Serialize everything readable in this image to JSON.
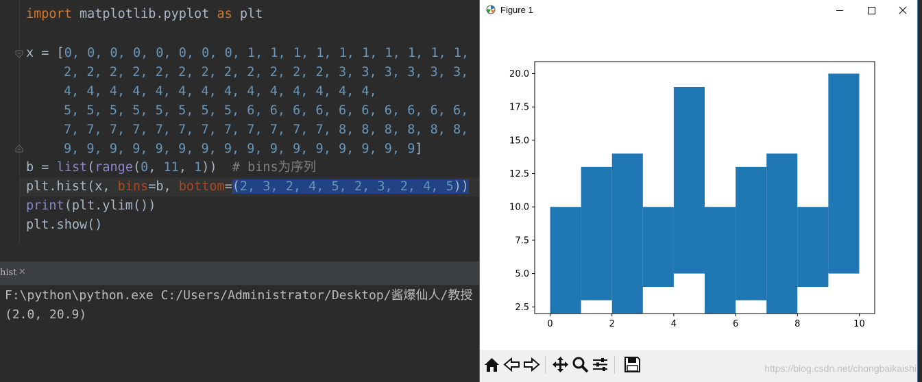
{
  "editor": {
    "line_import": {
      "kw1": "import",
      "mid": " matplotlib.pyplot ",
      "kw2": "as",
      "tail": " plt"
    },
    "x_prefix": "x = [",
    "x_rows": [
      "0, 0, 0, 0, 0, 0, 0, 0, 1, 1, 1, 1, 1, 1, 1, 1, 1, 1,",
      "2, 2, 2, 2, 2, 2, 2, 2, 2, 2, 2, 2, 3, 3, 3, 3, 3, 3,",
      "4, 4, 4, 4, 4, 4, 4, 4, 4, 4, 4, 4, 4, 4,",
      "5, 5, 5, 5, 5, 5, 5, 5, 6, 6, 6, 6, 6, 6, 6, 6, 6, 6,",
      "7, 7, 7, 7, 7, 7, 7, 7, 7, 7, 7, 7, 8, 8, 8, 8, 8, 8,",
      "9, 9, 9, 9, 9, 9, 9, 9, 9, 9, 9, 9, 9, 9, 9, 9"
    ],
    "x_suffix": "]",
    "line_b": {
      "a": "b = ",
      "fn1": "list",
      "p1": "(",
      "fn2": "range",
      "p2": "(",
      "n1": "0",
      "c1": ", ",
      "n2": "11",
      "c2": ", ",
      "n3": "1",
      "p3": "))",
      "comment": "  # bins为序列"
    },
    "line_hist": {
      "a": "plt.hist(x, ",
      "kw1": "bins",
      "eq1": "=b, ",
      "kw2": "bottom",
      "eq2": "=",
      "sel_open": "(",
      "sel_nums": "2, 3, 2, 4, 5, 2, 3, 2, 4, 5",
      "sel_close": "))"
    },
    "line_print": {
      "fn": "print",
      "rest": "(plt.ylim())"
    },
    "line_show": "plt.show()"
  },
  "run": {
    "tab_label": "hist",
    "tab_close": "✕",
    "console": [
      "F:\\python\\python.exe C:/Users/Administrator/Desktop/酱爆仙人/教授",
      "(2.0, 20.9)"
    ]
  },
  "figure": {
    "title": "Figure 1",
    "watermark": "https://blog.csdn.net/chongbaikaishi",
    "toolbar": [
      "home-icon",
      "back-icon",
      "forward-icon",
      "pan-icon",
      "zoom-icon",
      "configure-icon",
      "save-icon"
    ]
  },
  "chart_data": {
    "type": "bar",
    "bins": [
      0,
      1,
      2,
      3,
      4,
      5,
      6,
      7,
      8,
      9,
      10
    ],
    "bottom": [
      2,
      3,
      2,
      4,
      5,
      2,
      3,
      2,
      4,
      5
    ],
    "counts": [
      8,
      10,
      12,
      6,
      14,
      8,
      10,
      12,
      6,
      15
    ],
    "top": [
      10,
      13,
      14,
      10,
      19,
      10,
      13,
      14,
      10,
      20
    ],
    "xlim": [
      -0.5,
      10.5
    ],
    "ylim": [
      2.0,
      20.9
    ],
    "xticks": [
      0,
      2,
      4,
      6,
      8,
      10
    ],
    "yticks": [
      "2.5",
      "5.0",
      "7.5",
      "10.0",
      "12.5",
      "15.0",
      "17.5",
      "20.0"
    ],
    "bar_color": "#1f77b4"
  }
}
